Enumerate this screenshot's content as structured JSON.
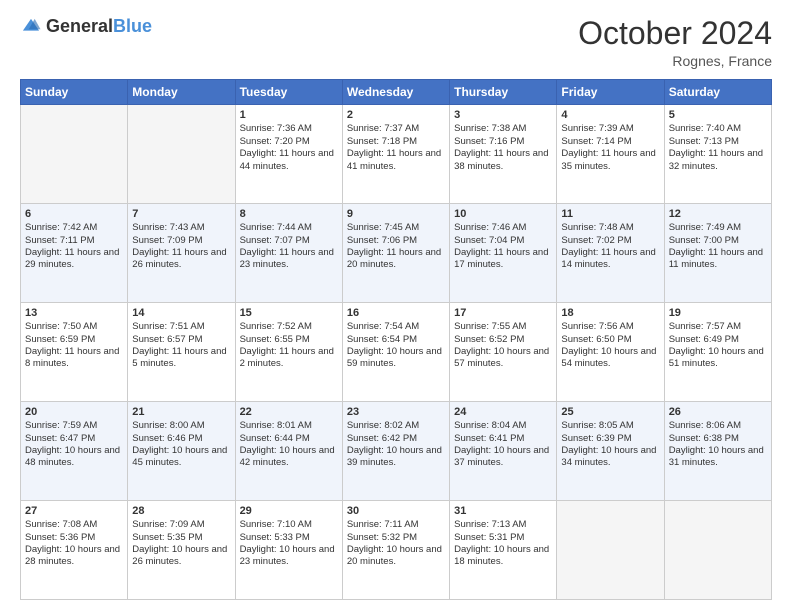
{
  "header": {
    "logo_general": "General",
    "logo_blue": "Blue",
    "month_title": "October 2024",
    "location": "Rognes, France"
  },
  "days_of_week": [
    "Sunday",
    "Monday",
    "Tuesday",
    "Wednesday",
    "Thursday",
    "Friday",
    "Saturday"
  ],
  "weeks": [
    [
      {
        "day": "",
        "empty": true
      },
      {
        "day": "",
        "empty": true
      },
      {
        "day": "1",
        "sunrise": "Sunrise: 7:36 AM",
        "sunset": "Sunset: 7:20 PM",
        "daylight": "Daylight: 11 hours and 44 minutes."
      },
      {
        "day": "2",
        "sunrise": "Sunrise: 7:37 AM",
        "sunset": "Sunset: 7:18 PM",
        "daylight": "Daylight: 11 hours and 41 minutes."
      },
      {
        "day": "3",
        "sunrise": "Sunrise: 7:38 AM",
        "sunset": "Sunset: 7:16 PM",
        "daylight": "Daylight: 11 hours and 38 minutes."
      },
      {
        "day": "4",
        "sunrise": "Sunrise: 7:39 AM",
        "sunset": "Sunset: 7:14 PM",
        "daylight": "Daylight: 11 hours and 35 minutes."
      },
      {
        "day": "5",
        "sunrise": "Sunrise: 7:40 AM",
        "sunset": "Sunset: 7:13 PM",
        "daylight": "Daylight: 11 hours and 32 minutes."
      }
    ],
    [
      {
        "day": "6",
        "sunrise": "Sunrise: 7:42 AM",
        "sunset": "Sunset: 7:11 PM",
        "daylight": "Daylight: 11 hours and 29 minutes."
      },
      {
        "day": "7",
        "sunrise": "Sunrise: 7:43 AM",
        "sunset": "Sunset: 7:09 PM",
        "daylight": "Daylight: 11 hours and 26 minutes."
      },
      {
        "day": "8",
        "sunrise": "Sunrise: 7:44 AM",
        "sunset": "Sunset: 7:07 PM",
        "daylight": "Daylight: 11 hours and 23 minutes."
      },
      {
        "day": "9",
        "sunrise": "Sunrise: 7:45 AM",
        "sunset": "Sunset: 7:06 PM",
        "daylight": "Daylight: 11 hours and 20 minutes."
      },
      {
        "day": "10",
        "sunrise": "Sunrise: 7:46 AM",
        "sunset": "Sunset: 7:04 PM",
        "daylight": "Daylight: 11 hours and 17 minutes."
      },
      {
        "day": "11",
        "sunrise": "Sunrise: 7:48 AM",
        "sunset": "Sunset: 7:02 PM",
        "daylight": "Daylight: 11 hours and 14 minutes."
      },
      {
        "day": "12",
        "sunrise": "Sunrise: 7:49 AM",
        "sunset": "Sunset: 7:00 PM",
        "daylight": "Daylight: 11 hours and 11 minutes."
      }
    ],
    [
      {
        "day": "13",
        "sunrise": "Sunrise: 7:50 AM",
        "sunset": "Sunset: 6:59 PM",
        "daylight": "Daylight: 11 hours and 8 minutes."
      },
      {
        "day": "14",
        "sunrise": "Sunrise: 7:51 AM",
        "sunset": "Sunset: 6:57 PM",
        "daylight": "Daylight: 11 hours and 5 minutes."
      },
      {
        "day": "15",
        "sunrise": "Sunrise: 7:52 AM",
        "sunset": "Sunset: 6:55 PM",
        "daylight": "Daylight: 11 hours and 2 minutes."
      },
      {
        "day": "16",
        "sunrise": "Sunrise: 7:54 AM",
        "sunset": "Sunset: 6:54 PM",
        "daylight": "Daylight: 10 hours and 59 minutes."
      },
      {
        "day": "17",
        "sunrise": "Sunrise: 7:55 AM",
        "sunset": "Sunset: 6:52 PM",
        "daylight": "Daylight: 10 hours and 57 minutes."
      },
      {
        "day": "18",
        "sunrise": "Sunrise: 7:56 AM",
        "sunset": "Sunset: 6:50 PM",
        "daylight": "Daylight: 10 hours and 54 minutes."
      },
      {
        "day": "19",
        "sunrise": "Sunrise: 7:57 AM",
        "sunset": "Sunset: 6:49 PM",
        "daylight": "Daylight: 10 hours and 51 minutes."
      }
    ],
    [
      {
        "day": "20",
        "sunrise": "Sunrise: 7:59 AM",
        "sunset": "Sunset: 6:47 PM",
        "daylight": "Daylight: 10 hours and 48 minutes."
      },
      {
        "day": "21",
        "sunrise": "Sunrise: 8:00 AM",
        "sunset": "Sunset: 6:46 PM",
        "daylight": "Daylight: 10 hours and 45 minutes."
      },
      {
        "day": "22",
        "sunrise": "Sunrise: 8:01 AM",
        "sunset": "Sunset: 6:44 PM",
        "daylight": "Daylight: 10 hours and 42 minutes."
      },
      {
        "day": "23",
        "sunrise": "Sunrise: 8:02 AM",
        "sunset": "Sunset: 6:42 PM",
        "daylight": "Daylight: 10 hours and 39 minutes."
      },
      {
        "day": "24",
        "sunrise": "Sunrise: 8:04 AM",
        "sunset": "Sunset: 6:41 PM",
        "daylight": "Daylight: 10 hours and 37 minutes."
      },
      {
        "day": "25",
        "sunrise": "Sunrise: 8:05 AM",
        "sunset": "Sunset: 6:39 PM",
        "daylight": "Daylight: 10 hours and 34 minutes."
      },
      {
        "day": "26",
        "sunrise": "Sunrise: 8:06 AM",
        "sunset": "Sunset: 6:38 PM",
        "daylight": "Daylight: 10 hours and 31 minutes."
      }
    ],
    [
      {
        "day": "27",
        "sunrise": "Sunrise: 7:08 AM",
        "sunset": "Sunset: 5:36 PM",
        "daylight": "Daylight: 10 hours and 28 minutes."
      },
      {
        "day": "28",
        "sunrise": "Sunrise: 7:09 AM",
        "sunset": "Sunset: 5:35 PM",
        "daylight": "Daylight: 10 hours and 26 minutes."
      },
      {
        "day": "29",
        "sunrise": "Sunrise: 7:10 AM",
        "sunset": "Sunset: 5:33 PM",
        "daylight": "Daylight: 10 hours and 23 minutes."
      },
      {
        "day": "30",
        "sunrise": "Sunrise: 7:11 AM",
        "sunset": "Sunset: 5:32 PM",
        "daylight": "Daylight: 10 hours and 20 minutes."
      },
      {
        "day": "31",
        "sunrise": "Sunrise: 7:13 AM",
        "sunset": "Sunset: 5:31 PM",
        "daylight": "Daylight: 10 hours and 18 minutes."
      },
      {
        "day": "",
        "empty": true
      },
      {
        "day": "",
        "empty": true
      }
    ]
  ]
}
